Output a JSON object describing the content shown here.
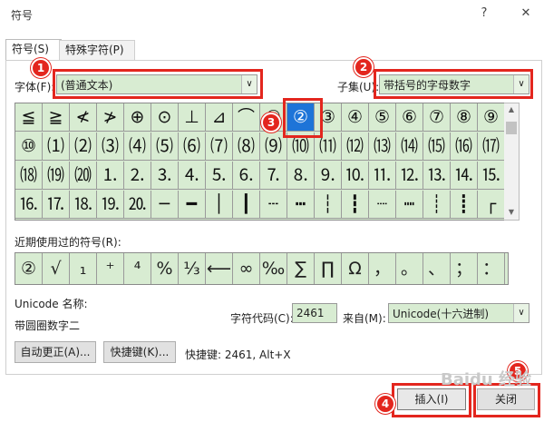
{
  "window": {
    "title": "符号",
    "help_glyph": "?",
    "close_glyph": "✕"
  },
  "tabs": [
    {
      "label": "符号(S)"
    },
    {
      "label": "特殊字符(P)"
    }
  ],
  "font": {
    "label": "字体(F):",
    "value": "(普通文本)"
  },
  "subset": {
    "label": "子集(U):",
    "value": "带括号的字母数字"
  },
  "symbols": [
    [
      "≦",
      "≧",
      "≮",
      "≯",
      "⊕",
      "⊙",
      "⊥",
      "⊿",
      "⌒",
      "①",
      "②",
      "③",
      "④",
      "⑤",
      "⑥",
      "⑦",
      "⑧",
      "⑨"
    ],
    [
      "⑩",
      "⑴",
      "⑵",
      "⑶",
      "⑷",
      "⑸",
      "⑹",
      "⑺",
      "⑻",
      "⑼",
      "⑽",
      "⑾",
      "⑿",
      "⒀",
      "⒁",
      "⒂",
      "⒃",
      "⒄"
    ],
    [
      "⒅",
      "⒆",
      "⒇",
      "⒈",
      "⒉",
      "⒊",
      "⒋",
      "⒌",
      "⒍",
      "⒎",
      "⒏",
      "⒐",
      "⒑",
      "⒒",
      "⒓",
      "⒔",
      "⒕",
      "⒖"
    ],
    [
      "⒗",
      "⒘",
      "⒙",
      "⒚",
      "⒛",
      "─",
      "━",
      "│",
      "┃",
      "┄",
      "┅",
      "┆",
      "┇",
      "┈",
      "┉",
      "┊",
      "┋",
      "┌"
    ]
  ],
  "selected_symbol": {
    "row": 0,
    "col": 10
  },
  "recent": {
    "label": "近期使用过的符号(R):",
    "items": [
      "②",
      "√",
      "₁",
      "⁺",
      "⁴",
      "%",
      "⅓",
      "⟵",
      "∞",
      "‰",
      "∑",
      "∏",
      "Ω",
      "，",
      "。",
      "、",
      "；",
      "："
    ]
  },
  "unicode_name": {
    "label": "Unicode 名称:",
    "value": "带圆圈数字二"
  },
  "char_code": {
    "label": "字符代码(C):",
    "value": "2461"
  },
  "from": {
    "label": "来自(M):",
    "value": "Unicode(十六进制)"
  },
  "buttons": {
    "autocorrect": "自动更正(A)...",
    "shortcut_key": "快捷键(K)...",
    "shortcut_info": "快捷键: 2461, Alt+X",
    "insert": "插入(I)",
    "close": "关闭"
  },
  "badges": [
    "1",
    "2",
    "3",
    "4",
    "5"
  ],
  "watermark": "Baidu 经验",
  "colors": {
    "annotation": "#e3261e",
    "grid_bg": "#d8ecd2",
    "selected": "#1e74d8"
  }
}
